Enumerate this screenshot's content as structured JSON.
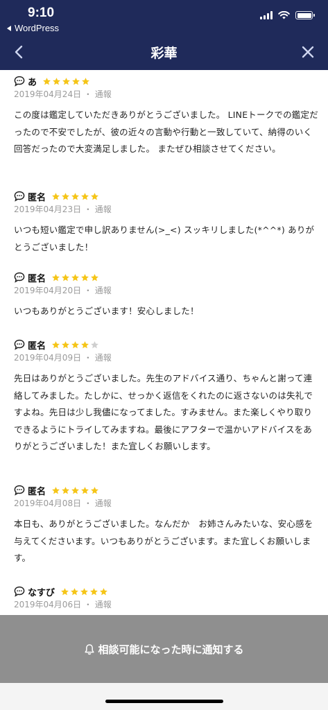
{
  "status_bar": {
    "time": "9:10",
    "back_app": "WordPress"
  },
  "nav": {
    "title": "彩華"
  },
  "reviews": [
    {
      "name": "あ",
      "stars": 5,
      "date": "2019年04月24日",
      "separator": "・",
      "report": "通報",
      "body": "この度は鑑定していただきありがとうございました。 LINEトークでの鑑定だったので不安でしたが、彼の近々の言動や行動と一致していて、納得のいく回答だったので大変満足しました。 またぜひ相談させてください。"
    },
    {
      "name": "匿名",
      "stars": 5,
      "date": "2019年04月23日",
      "separator": "・",
      "report": "通報",
      "body": "いつも短い鑑定で申し訳ありません(>_<) スッキリしました(*^^*) ありがとうございました！"
    },
    {
      "name": "匿名",
      "stars": 5,
      "date": "2019年04月20日",
      "separator": "・",
      "report": "通報",
      "body": "いつもありがとうございます！安心しました！"
    },
    {
      "name": "匿名",
      "stars": 4,
      "date": "2019年04月09日",
      "separator": "・",
      "report": "通報",
      "body": "先日はありがとうございました。先生のアドバイス通り、ちゃんと謝って連絡してみました。たしかに、せっかく返信をくれたのに返さないのは失礼ですよね。先日は少し我儘になってました。すみません。また楽しくやり取りできるようにトライしてみますね。最後にアフターで温かいアドバイスをありがとうございました！また宜しくお願いします。"
    },
    {
      "name": "匿名",
      "stars": 5,
      "date": "2019年04月08日",
      "separator": "・",
      "report": "通報",
      "body": "本日も、ありがとうございました。なんだか　お姉さんみたいな、安心感を与えてくださいます。いつもありがとうございます。また宜しくお願いします。"
    },
    {
      "name": "なすび",
      "stars": 5,
      "date": "2019年04月06日",
      "separator": "・",
      "report": "通報",
      "body": ""
    }
  ],
  "footer": {
    "notify_label": "相談可能になった時に通知する"
  },
  "colors": {
    "header_bg": "#1f2a5a",
    "star_on": "#f5c518",
    "star_off": "#cfcfcf",
    "footer_bg": "#8f8f8f",
    "meta_text": "#9a9a9a"
  },
  "icons": {
    "nav_back": "chevron-left-icon",
    "nav_close": "close-icon",
    "reviewer": "chat-bubble-icon",
    "rating": "star-icon",
    "notify": "bell-icon"
  }
}
